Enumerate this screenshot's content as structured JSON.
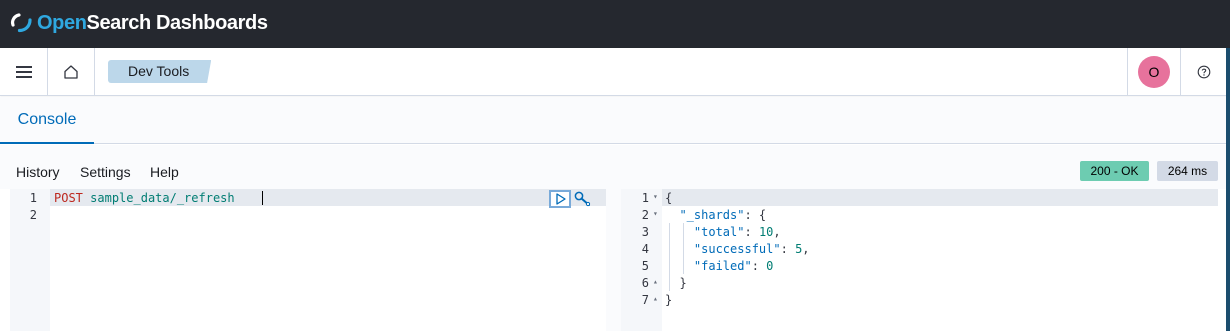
{
  "header": {
    "brand_open": "Open",
    "brand_rest": "Search Dashboards"
  },
  "nav": {
    "breadcrumb": "Dev Tools",
    "avatar_initial": "O"
  },
  "tabs": [
    {
      "label": "Console",
      "selected": true
    }
  ],
  "toolbar": {
    "history": "History",
    "settings": "Settings",
    "help": "Help",
    "status": "200 - OK",
    "time": "264 ms"
  },
  "request": {
    "line_numbers": [
      "1",
      "2"
    ],
    "method": "POST",
    "path": "sample_data/_refresh"
  },
  "response": {
    "line_numbers": [
      "1",
      "2",
      "3",
      "4",
      "5",
      "6",
      "7"
    ],
    "open_brace": "{",
    "shards_key": "\"_shards\"",
    "colon_brace": ": {",
    "total_key": "\"total\"",
    "total_value": "10",
    "successful_key": "\"successful\"",
    "successful_value": "5",
    "failed_key": "\"failed\"",
    "failed_value": "0",
    "inner_close": "}",
    "outer_close": "}"
  },
  "colors": {
    "header_bg": "#25282f",
    "accent": "#006bb8",
    "status_ok": "#6dccb1",
    "avatar": "#e7729c"
  }
}
